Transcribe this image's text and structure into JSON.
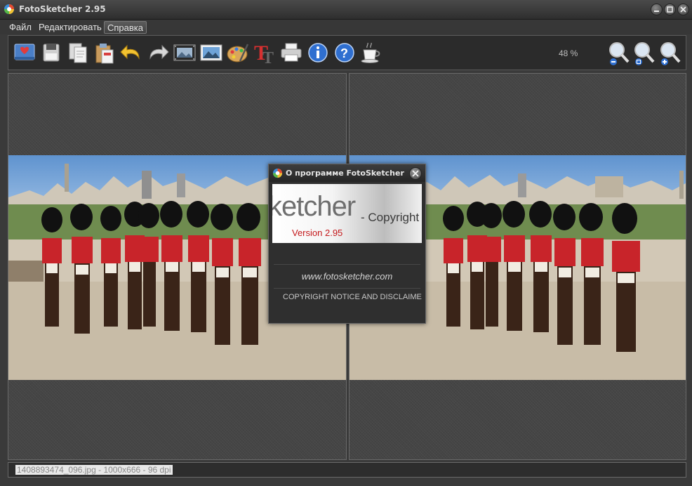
{
  "window": {
    "title": "FotoSketcher 2.95",
    "controls": [
      "minimize-icon",
      "maximize-icon",
      "close-icon"
    ]
  },
  "menu": {
    "items": [
      "Файл",
      "Редактировать",
      "Справка"
    ],
    "active_index": 2
  },
  "toolbar": {
    "buttons": [
      "open-image-icon",
      "save-icon",
      "copy-icon",
      "paste-icon",
      "undo-icon",
      "redo-icon",
      "film-icon",
      "landscape-icon",
      "palette-icon",
      "text-icon",
      "print-icon",
      "info-icon",
      "help-icon",
      "coffee-icon"
    ],
    "zoom_value": "48 %",
    "zoom_buttons": [
      "zoom-out-icon",
      "zoom-fit-icon",
      "zoom-in-icon"
    ]
  },
  "status": {
    "text": "1408893474_096.jpg - 1000x666 - 96 dpi"
  },
  "about_dialog": {
    "title": "О программе FotoSketcher",
    "logo_text": "ketcher",
    "copyright_text": "- Copyright D",
    "version": "Version 2.95",
    "url": "www.fotosketcher.com",
    "notice": "COPYRIGHT NOTICE AND DISCLAIME"
  },
  "colors": {
    "background": "#3a3a3a",
    "version_red": "#c4181b",
    "status_highlight": "#e8e8e8"
  }
}
